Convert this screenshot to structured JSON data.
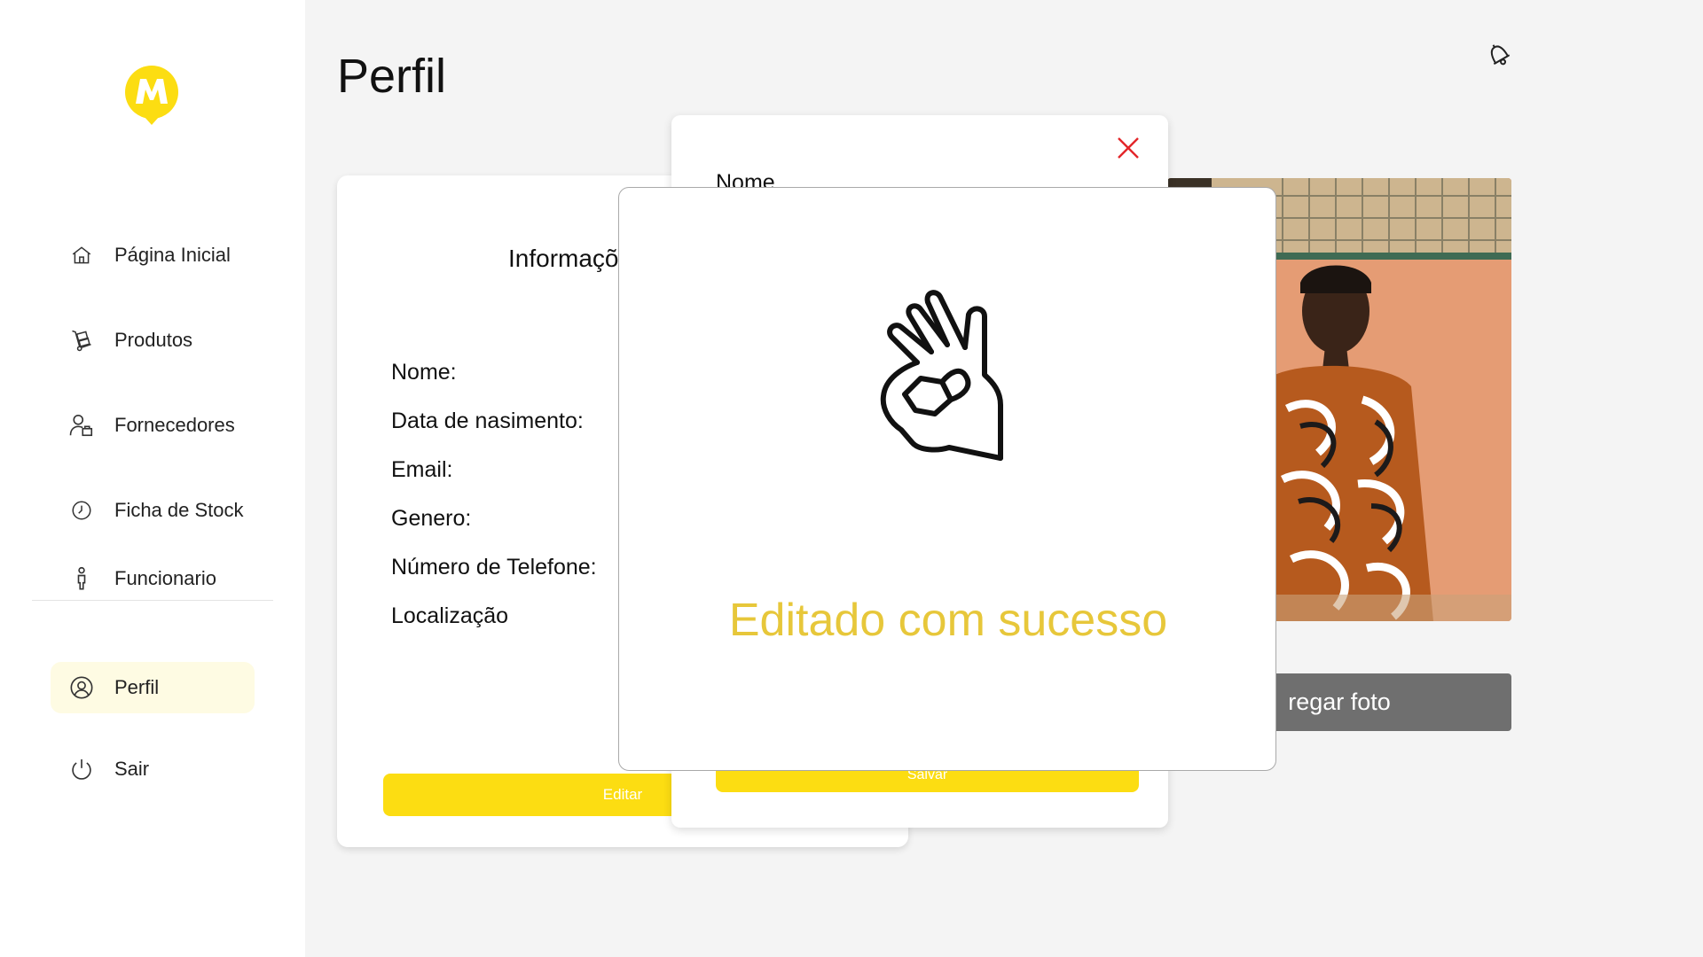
{
  "sidebar": {
    "logo_icon": "brand-logo-icon",
    "items": [
      {
        "label": "Página Inicial",
        "icon": "home-icon"
      },
      {
        "label": "Produtos",
        "icon": "hand-truck-icon"
      },
      {
        "label": "Fornecedores",
        "icon": "supplier-user-icon"
      },
      {
        "label": "Ficha de Stock",
        "icon": "clock-icon"
      },
      {
        "label": "Funcionario",
        "icon": "person-icon"
      },
      {
        "label": "Perfil",
        "icon": "user-circle-icon",
        "active": true
      },
      {
        "label": "Sair",
        "icon": "power-icon"
      }
    ]
  },
  "header": {
    "title": "Perfil",
    "notification_icon": "bell-icon"
  },
  "info_card": {
    "title": "Informaçõ",
    "fields": [
      "Nome:",
      "Data de nasimento:",
      "Email:",
      "Genero:",
      "Número de Telefone:",
      "Localização"
    ],
    "edit_label": "Editar"
  },
  "edit_card": {
    "name_label": "Nome",
    "save_label": "Salvar",
    "close_icon": "close-icon"
  },
  "photo": {
    "upload_label": "regar foto"
  },
  "success_modal": {
    "message": "Editado com sucesso",
    "icon": "ok-hand-icon"
  },
  "colors": {
    "accent_yellow": "#fcdd12",
    "success_text": "#e7c73a",
    "active_nav_bg": "#fefbe3",
    "close_red": "#e3262a",
    "upload_button": "#6f6f6f"
  }
}
